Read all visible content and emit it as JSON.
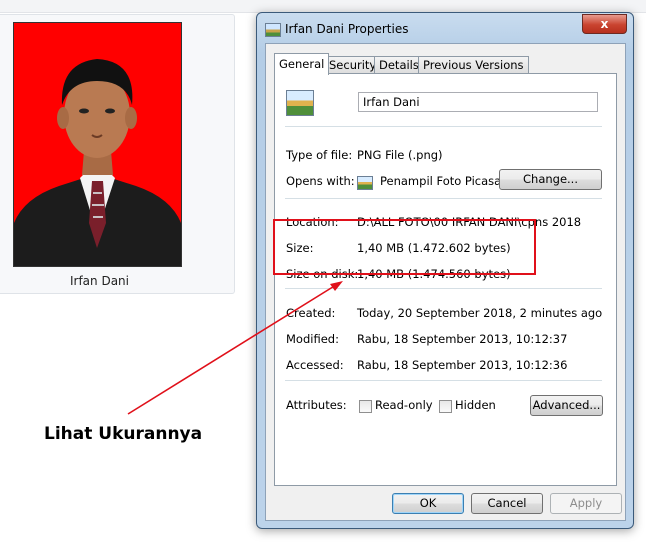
{
  "thumbnail": {
    "label": "Irfan Dani"
  },
  "dialog": {
    "title": "Irfan Dani Properties",
    "close_glyph": "x",
    "tabs": [
      "General",
      "Security",
      "Details",
      "Previous Versions"
    ],
    "file_name": "Irfan Dani",
    "type_of_file": {
      "label": "Type of file:",
      "value": "PNG File (.png)"
    },
    "opens_with": {
      "label": "Opens with:",
      "value": "Penampil Foto Picasa",
      "button": "Change..."
    },
    "location": {
      "label": "Location:",
      "value": "D:\\ALL FOTO\\00 IRFAN DANI\\cpns 2018"
    },
    "size": {
      "label": "Size:",
      "value": "1,40 MB (1.472.602 bytes)"
    },
    "size_on_disk": {
      "label": "Size on disk:",
      "value": "1,40 MB (1.474.560 bytes)"
    },
    "created": {
      "label": "Created:",
      "value": "Today, 20 September 2018, 2 minutes ago"
    },
    "modified": {
      "label": "Modified:",
      "value": "Rabu, 18 September 2013, 10:12:37"
    },
    "accessed": {
      "label": "Accessed:",
      "value": "Rabu, 18 September 2013, 10:12:36"
    },
    "attributes": {
      "label": "Attributes:",
      "read_only": "Read-only",
      "hidden": "Hidden",
      "advanced": "Advanced..."
    },
    "buttons": {
      "ok": "OK",
      "cancel": "Cancel",
      "apply": "Apply"
    }
  },
  "annotation": {
    "text": "Lihat Ukurannya",
    "color": "#e0101a"
  },
  "colors": {
    "photo_background": "#ff0000",
    "highlight": "#e0101a"
  }
}
